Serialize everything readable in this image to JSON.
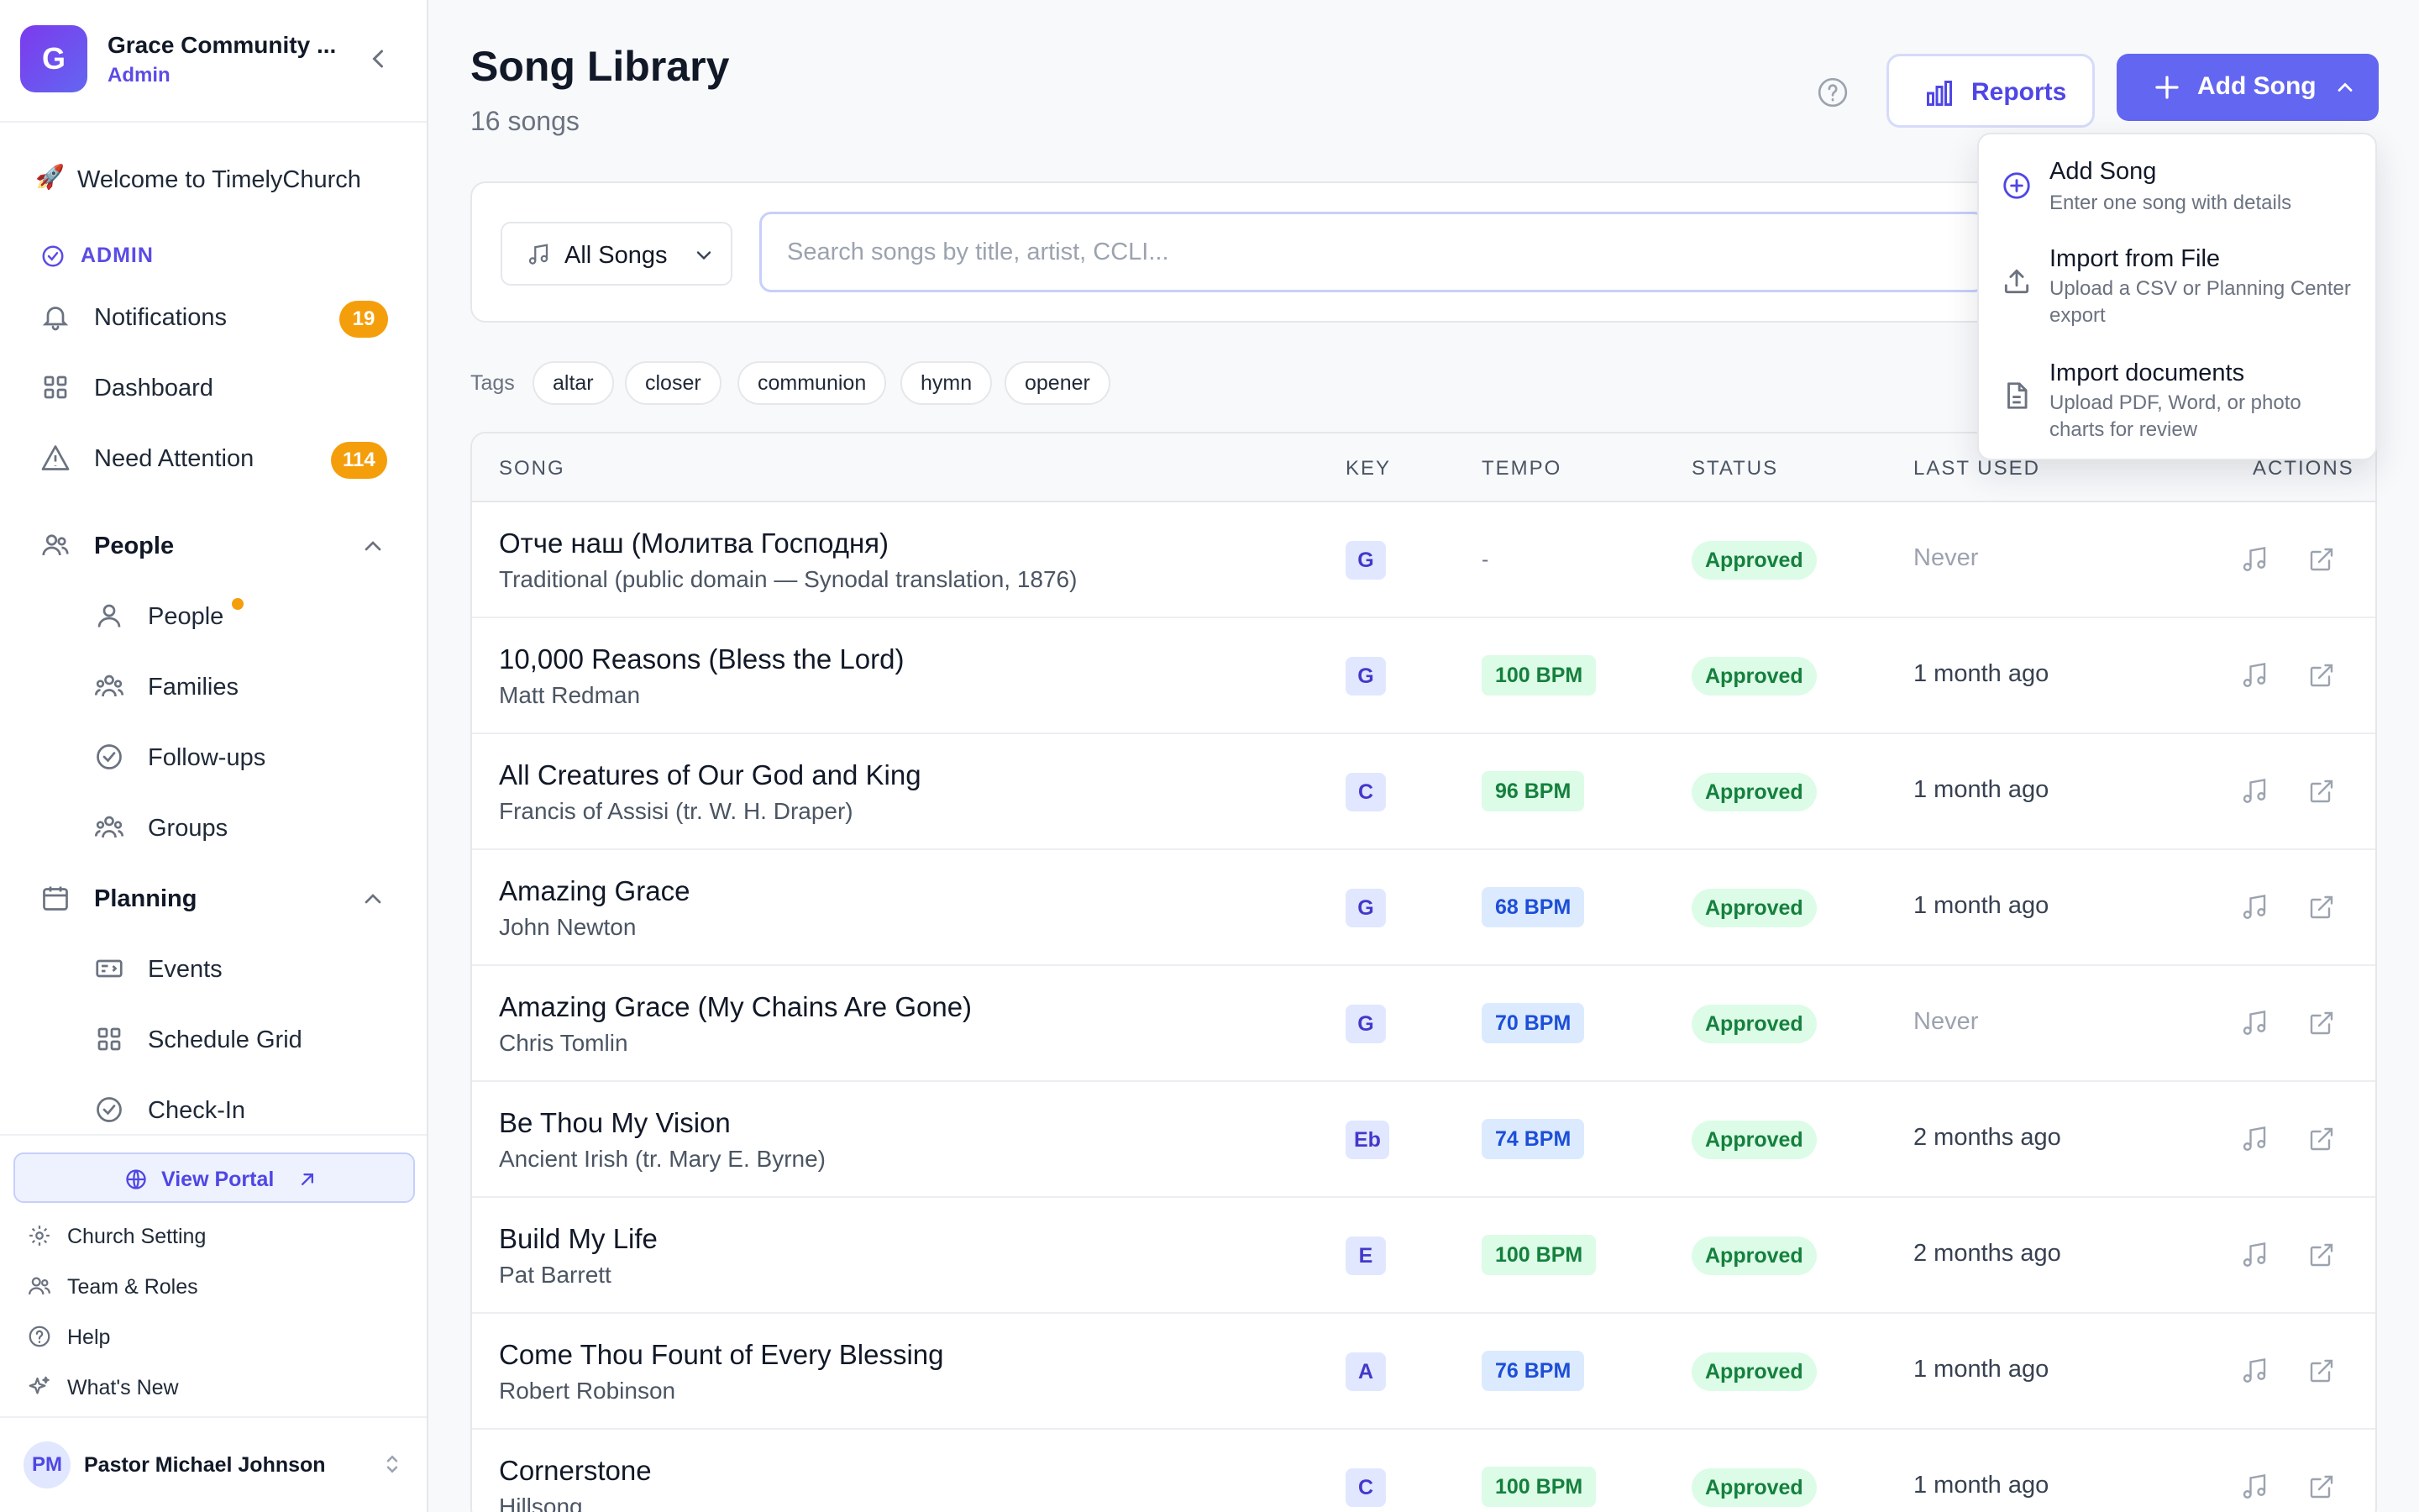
{
  "org": {
    "initial": "G",
    "name": "Grace Community ...",
    "role": "Admin"
  },
  "nav": {
    "welcome": "Welcome to TimelyChurch",
    "welcome_icon": "🚀",
    "admin_label": "ADMIN",
    "notifications": {
      "label": "Notifications",
      "count": "19"
    },
    "dashboard": "Dashboard",
    "need_attention": {
      "label": "Need Attention",
      "count": "114"
    },
    "people_section": "People",
    "people_items": [
      "People",
      "Families",
      "Follow-ups",
      "Groups"
    ],
    "planning_section": "Planning",
    "planning_items": [
      "Events",
      "Schedule Grid",
      "Check-In"
    ]
  },
  "sidebar_footer": {
    "portal": "View Portal",
    "items": [
      "Church Setting",
      "Team & Roles",
      "Help",
      "What's New"
    ]
  },
  "user": {
    "initials": "PM",
    "name": "Pastor Michael Johnson"
  },
  "header": {
    "title": "Song Library",
    "subtitle": "16 songs",
    "reports_label": "Reports",
    "add_label": "Add Song"
  },
  "filters": {
    "select_value": "All Songs",
    "search_placeholder": "Search songs by title, artist, CCLI..."
  },
  "tags": {
    "label": "Tags",
    "items": [
      "altar",
      "closer",
      "communion",
      "hymn",
      "opener"
    ]
  },
  "table": {
    "headers": [
      "SONG",
      "KEY",
      "TEMPO",
      "STATUS",
      "LAST USED",
      "ACTIONS"
    ],
    "rows": [
      {
        "title": "Отче наш (Молитва Господня)",
        "artist": "Traditional (public domain — Synodal translation, 1876)",
        "key": "G",
        "tempo": "-",
        "tempo_style": "none",
        "status": "Approved",
        "last_used": "Never"
      },
      {
        "title": "10,000 Reasons (Bless the Lord)",
        "artist": "Matt Redman",
        "key": "G",
        "tempo": "100 BPM",
        "tempo_style": "green",
        "status": "Approved",
        "last_used": "1 month ago"
      },
      {
        "title": "All Creatures of Our God and King",
        "artist": "Francis of Assisi (tr. W. H. Draper)",
        "key": "C",
        "tempo": "96 BPM",
        "tempo_style": "green",
        "status": "Approved",
        "last_used": "1 month ago"
      },
      {
        "title": "Amazing Grace",
        "artist": "John Newton",
        "key": "G",
        "tempo": "68 BPM",
        "tempo_style": "blue",
        "status": "Approved",
        "last_used": "1 month ago"
      },
      {
        "title": "Amazing Grace (My Chains Are Gone)",
        "artist": "Chris Tomlin",
        "key": "G",
        "tempo": "70 BPM",
        "tempo_style": "blue",
        "status": "Approved",
        "last_used": "Never"
      },
      {
        "title": "Be Thou My Vision",
        "artist": "Ancient Irish (tr. Mary E. Byrne)",
        "key": "Eb",
        "tempo": "74 BPM",
        "tempo_style": "blue",
        "status": "Approved",
        "last_used": "2 months ago"
      },
      {
        "title": "Build My Life",
        "artist": "Pat Barrett",
        "key": "E",
        "tempo": "100 BPM",
        "tempo_style": "green",
        "status": "Approved",
        "last_used": "2 months ago"
      },
      {
        "title": "Come Thou Fount of Every Blessing",
        "artist": "Robert Robinson",
        "key": "A",
        "tempo": "76 BPM",
        "tempo_style": "blue",
        "status": "Approved",
        "last_used": "1 month ago"
      },
      {
        "title": "Cornerstone",
        "artist": "Hillsong",
        "key": "C",
        "tempo": "100 BPM",
        "tempo_style": "green",
        "status": "Approved",
        "last_used": "1 month ago"
      }
    ]
  },
  "dropdown": [
    {
      "title": "Add Song",
      "desc": "Enter one song with details"
    },
    {
      "title": "Import from File",
      "desc": "Upload a CSV or Planning Center export"
    },
    {
      "title": "Import documents",
      "desc": "Upload PDF, Word, or photo charts for review"
    }
  ],
  "colors": {
    "accent": "#6366f1",
    "accent_text": "#4f46e5",
    "badge": "#f59e0b",
    "approved_bg": "#dcfce7",
    "approved_text": "#15803d"
  }
}
